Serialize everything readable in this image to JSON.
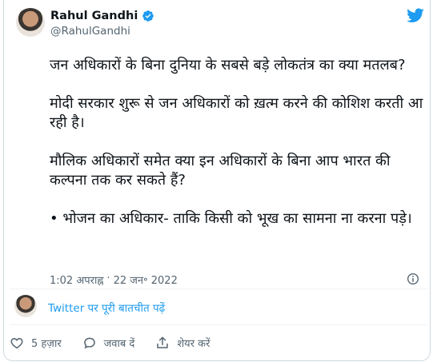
{
  "author": {
    "name": "Rahul Gandhi",
    "handle": "@RahulGandhi",
    "verified": true
  },
  "tweet": {
    "paragraphs": [
      "जन अधिकारों के बिना दुनिया के सबसे बड़े लोकतंत्र का क्या मतलब?",
      "मोदी सरकार शुरू से जन अधिकारों को ख़त्म करने की कोशिश करती आ रही है।",
      "मौलिक अधिकारों समेत क्या इन अधिकारों के बिना आप भारत की कल्पना तक कर सकते हैं?",
      "• भोजन का अधिकार- ताकि किसी को भूख का सामना ना करना पड़े।"
    ],
    "time": "1:02 अपराह्न",
    "separator": "·",
    "date": "22 जन॰ 2022"
  },
  "conversation_link": "Twitter पर पूरी बातचीत पढ़ें",
  "actions": {
    "like_count": "5 हज़ार",
    "reply_label": "जवाब दें",
    "share_label": "शेयर करें"
  },
  "colors": {
    "accent": "#1d9bf0",
    "muted": "#536471",
    "text": "#0f1419",
    "like": "#f91880"
  },
  "icons": [
    "twitter-bird-icon",
    "verified-badge-icon",
    "info-icon",
    "heart-icon",
    "reply-icon",
    "share-icon"
  ]
}
